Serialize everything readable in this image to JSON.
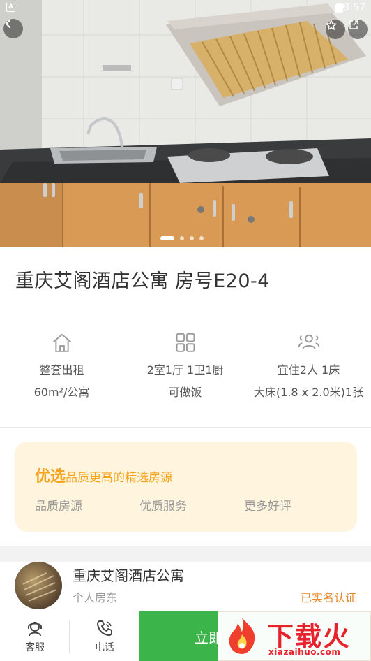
{
  "status_bar": {
    "time": "3:57"
  },
  "hero": {
    "page_indicator": {
      "count": 4,
      "active": 1
    }
  },
  "title": "重庆艾阁酒店公寓 房号E20-4",
  "features": [
    {
      "icon": "house-icon",
      "line1": "整套出租",
      "line2": "60m²/公寓"
    },
    {
      "icon": "grid-icon",
      "line1": "2室1厅 1卫1厨",
      "line2": "可做饭"
    },
    {
      "icon": "people-icon",
      "line1": "宜住2人 1床",
      "line2": "大床(1.8 x 2.0米)1张"
    }
  ],
  "preferred": {
    "title": "优选",
    "subtitle": "品质更高的精选房源",
    "items": [
      "品质房源",
      "优质服务",
      "更多好评"
    ]
  },
  "host": {
    "name": "重庆艾阁酒店公寓",
    "type": "个人房东",
    "verified": "已实名认证"
  },
  "bottom_bar": {
    "service_label": "客服",
    "phone_label": "电话",
    "book_label": "立即"
  },
  "watermark": {
    "text": "下载火",
    "url": "xiazaihuo.com"
  },
  "colors": {
    "accent_green": "#3bb54a",
    "accent_orange": "#f5a31b",
    "verify_orange": "#e6892f"
  }
}
